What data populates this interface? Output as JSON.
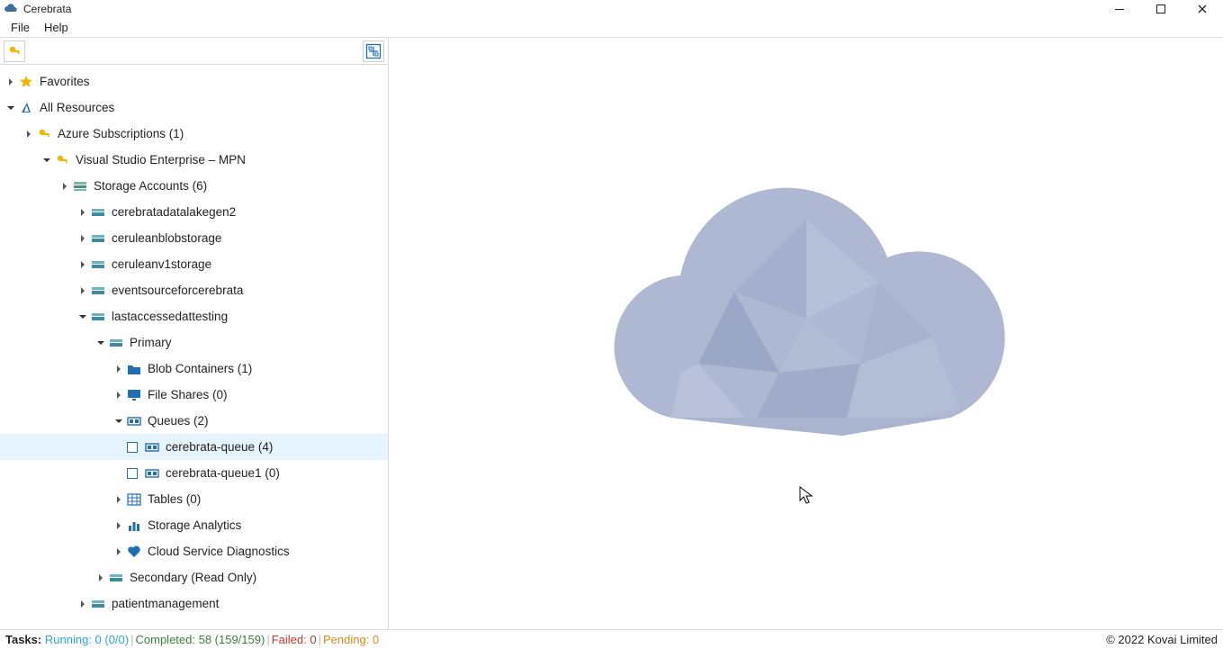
{
  "app": {
    "title": "Cerebrata"
  },
  "menu": {
    "file": "File",
    "help": "Help"
  },
  "tree": {
    "favorites": "Favorites",
    "allResources": "All Resources",
    "azureSubs": "Azure Subscriptions (1)",
    "vsEnterprise": "Visual Studio Enterprise – MPN",
    "storageAccounts": "Storage Accounts (6)",
    "sa": {
      "cerebratadatalakegen2": "cerebratadatalakegen2",
      "ceruleanblobstorage": "ceruleanblobstorage",
      "ceruleanv1storage": "ceruleanv1storage",
      "eventsourceforcerebrata": "eventsourceforcerebrata",
      "lastaccessedattesting": "lastaccessedattesting",
      "patientmanagement": "patientmanagement"
    },
    "primary": "Primary",
    "blobContainers": "Blob Containers (1)",
    "fileShares": "File Shares (0)",
    "queues": "Queues (2)",
    "queueItems": {
      "q1": "cerebrata-queue (4)",
      "q2": "cerebrata-queue1 (0)"
    },
    "tables": "Tables (0)",
    "storageAnalytics": "Storage Analytics",
    "cloudDiag": "Cloud Service Diagnostics",
    "secondary": "Secondary (Read Only)"
  },
  "status": {
    "tasks": "Tasks",
    "running": "Running: 0 (0/0)",
    "completed": "Completed: 58 (159/159)",
    "failed": "Failed: 0",
    "pending": "Pending: 0",
    "copyright": "© 2022 Kovai Limited"
  }
}
